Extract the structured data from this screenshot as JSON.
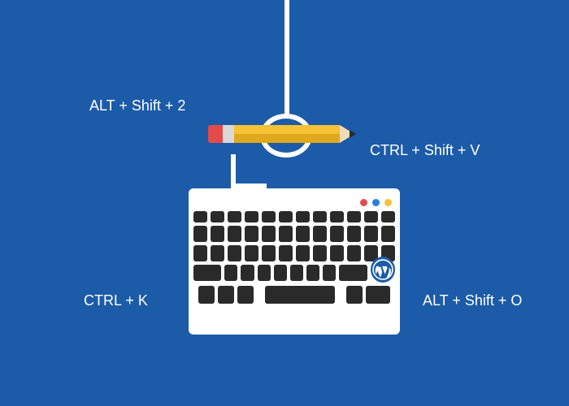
{
  "shortcuts": {
    "top_left": "ALT + Shift + 2",
    "top_right": "CTRL + Shift + V",
    "bottom_left": "CTRL + K",
    "bottom_right": "ALT + Shift + O"
  },
  "colors": {
    "background": "#1c5ba8",
    "key": "#2a2a2a",
    "dot_red": "#e34b4b",
    "dot_blue": "#2b7de0",
    "dot_yellow": "#f6c233",
    "pencil_body": "#f6c233",
    "pencil_eraser": "#e34b4b"
  },
  "icons": {
    "logo": "wordpress-logo"
  }
}
